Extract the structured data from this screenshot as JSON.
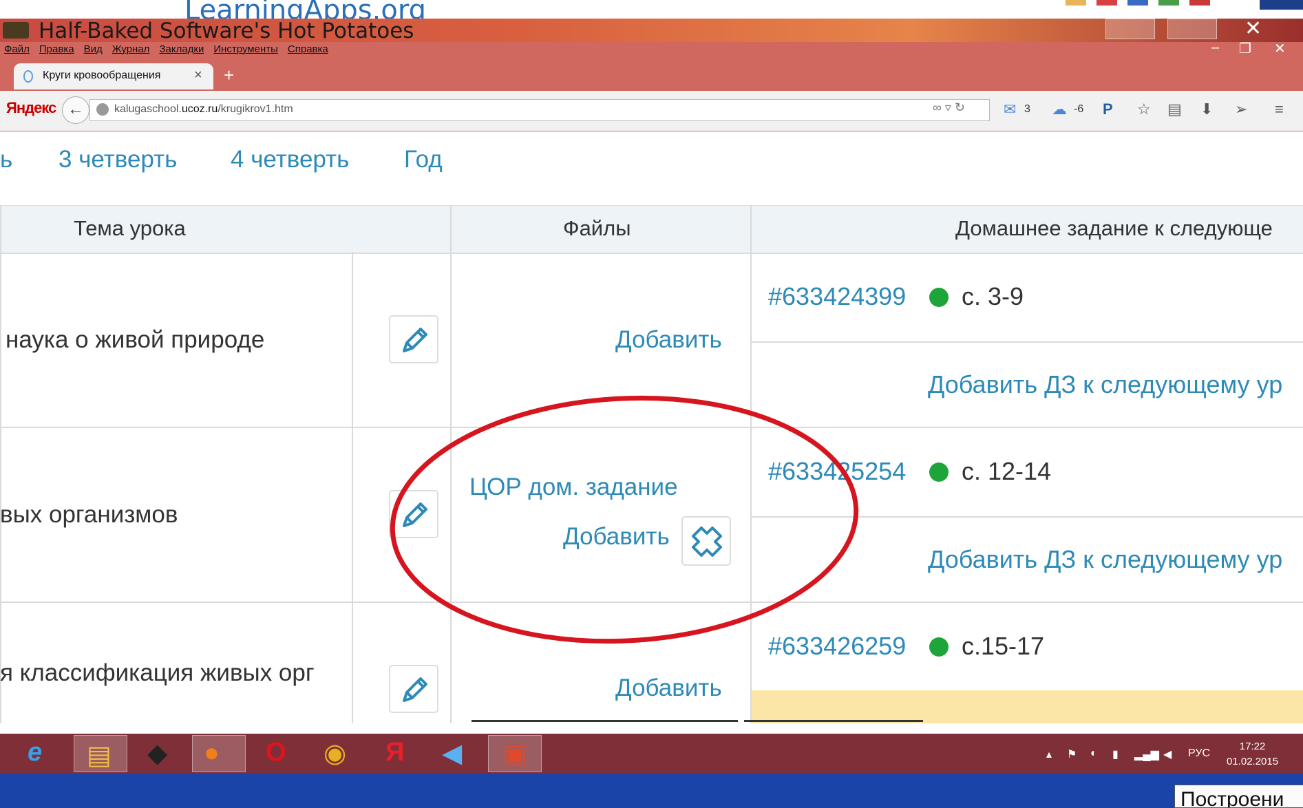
{
  "background_app": {
    "title": "LearningApps.org"
  },
  "hotpotatoes": {
    "title": "Half-Baked Software's Hot Potatoes"
  },
  "firefox": {
    "menu": [
      "Файл",
      "Правка",
      "Вид",
      "Журнал",
      "Закладки",
      "Инструменты",
      "Справка"
    ],
    "tab": {
      "label": "Круги кровообращения",
      "close": "×"
    },
    "new_tab": "+",
    "yandex": "Яндекс",
    "url": {
      "prefix": "kalugaschool.",
      "domain": "ucoz.ru",
      "path": "/krugikrov1.htm"
    },
    "toolbar": {
      "mail_count": "3",
      "weather": "-6"
    }
  },
  "page": {
    "quarters": [
      "ь",
      "3 четверть",
      "4 четверть",
      "Год"
    ],
    "headers": {
      "topic": "Тема урока",
      "files": "Файлы",
      "homework": "Домашнее задание к следующе"
    },
    "rows": [
      {
        "topic": "наука о живой природе",
        "file": "",
        "add": "Добавить",
        "hw_id": "#633424399",
        "hw_pages": "с. 3-9",
        "add_hw": "Добавить ДЗ к следующему ур"
      },
      {
        "topic": "вых организмов",
        "file": "ЦОР дом. задание",
        "add": "Добавить",
        "hw_id": "#633425254",
        "hw_pages": "с. 12-14",
        "add_hw": "Добавить ДЗ к следующему ур"
      },
      {
        "topic": "я классификация живых орг",
        "file": "",
        "add": "Добавить",
        "hw_id": "#633426259",
        "hw_pages": "с.15-17",
        "add_hw": ""
      }
    ]
  },
  "taskbar": {
    "apps": [
      "internet-explorer-icon",
      "file-explorer-icon",
      "hot-potatoes-icon",
      "firefox-icon",
      "opera-icon",
      "chrome-icon",
      "yandex-browser-icon",
      "audio-icon",
      "presentation-icon"
    ],
    "lang": "РУС",
    "time": "17:22",
    "date": "01.02.2015"
  },
  "tooltip": "Построени",
  "colors": {
    "link": "#2d8ab7",
    "status_dot": "#1ea53a",
    "annotation": "#d6151f",
    "taskbar": "#7f2f37"
  }
}
